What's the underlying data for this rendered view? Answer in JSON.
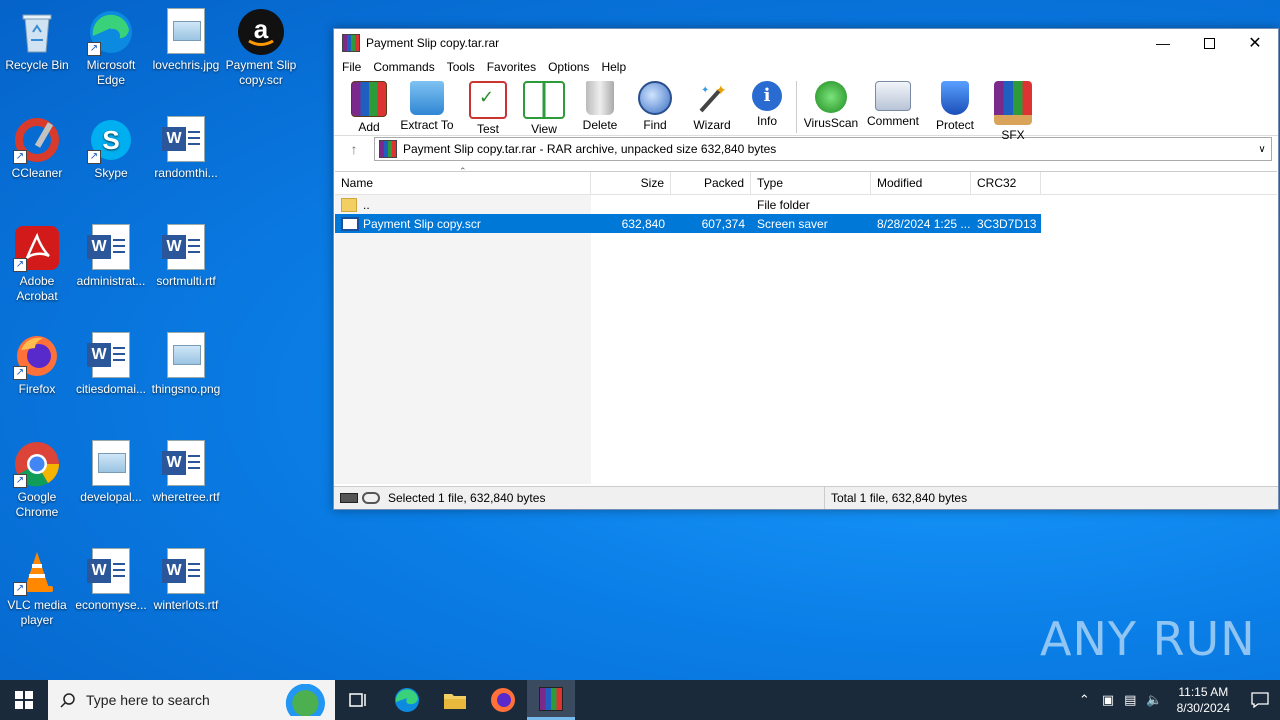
{
  "desktop": {
    "icons": [
      {
        "label": "Recycle Bin"
      },
      {
        "label": "Microsoft Edge"
      },
      {
        "label": "lovechris.jpg"
      },
      {
        "label": "Payment Slip copy.scr"
      },
      {
        "label": "CCleaner"
      },
      {
        "label": "Skype"
      },
      {
        "label": "randomthi..."
      },
      {
        "label": "Adobe Acrobat"
      },
      {
        "label": "administrat..."
      },
      {
        "label": "sortmulti.rtf"
      },
      {
        "label": "Firefox"
      },
      {
        "label": "citiesdomai..."
      },
      {
        "label": "thingsno.png"
      },
      {
        "label": "Google Chrome"
      },
      {
        "label": "developal..."
      },
      {
        "label": "wheretree.rtf"
      },
      {
        "label": "VLC media player"
      },
      {
        "label": "economyse..."
      },
      {
        "label": "winterlots.rtf"
      }
    ]
  },
  "window": {
    "title": "Payment Slip copy.tar.rar",
    "menu": [
      "File",
      "Commands",
      "Tools",
      "Favorites",
      "Options",
      "Help"
    ],
    "toolbar": [
      {
        "label": "Add",
        "icon": "add-archive-icon"
      },
      {
        "label": "Extract To",
        "icon": "extract-folder-icon"
      },
      {
        "label": "Test",
        "icon": "test-checklist-icon"
      },
      {
        "label": "View",
        "icon": "view-book-icon"
      },
      {
        "label": "Delete",
        "icon": "trash-icon"
      },
      {
        "label": "Find",
        "icon": "magnifier-icon"
      },
      {
        "label": "Wizard",
        "icon": "wand-icon"
      },
      {
        "label": "Info",
        "icon": "info-icon"
      },
      {
        "label": "VirusScan",
        "icon": "virus-scan-icon"
      },
      {
        "label": "Comment",
        "icon": "comment-icon"
      },
      {
        "label": "Protect",
        "icon": "shield-icon"
      },
      {
        "label": "SFX",
        "icon": "sfx-box-icon"
      }
    ],
    "address": "Payment Slip copy.tar.rar - RAR archive, unpacked size 632,840 bytes",
    "columns": [
      "Name",
      "Size",
      "Packed",
      "Type",
      "Modified",
      "CRC32"
    ],
    "rows": [
      {
        "name": "..",
        "size": "",
        "packed": "",
        "type": "File folder",
        "modified": "",
        "crc": ""
      },
      {
        "name": "Payment Slip copy.scr",
        "size": "632,840",
        "packed": "607,374",
        "type": "Screen saver",
        "modified": "8/28/2024 1:25 ...",
        "crc": "3C3D7D13"
      }
    ],
    "status_left": "Selected 1 file, 632,840 bytes",
    "status_right": "Total 1 file, 632,840 bytes"
  },
  "taskbar": {
    "search_placeholder": "Type here to search",
    "time": "11:15 AM",
    "date": "8/30/2024"
  },
  "watermark": "ANY RUN",
  "colors": {
    "selection": "#0078d7",
    "taskbar": "#1b2a3a",
    "desktop": "#0a7ee6"
  }
}
